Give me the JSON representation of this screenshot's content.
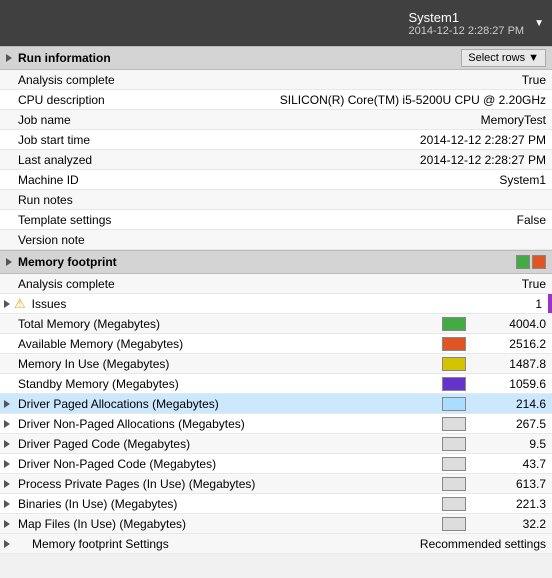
{
  "header": {
    "system_name": "System1",
    "system_date": "2014-12-12 2:28:27 PM",
    "dropdown_label": "System1"
  },
  "run_info": {
    "section_title": "Run information",
    "select_rows_label": "Select rows",
    "rows": [
      {
        "label": "Analysis complete",
        "value": "True",
        "indent": false
      },
      {
        "label": "CPU description",
        "value": "SILICON(R) Core(TM) i5-5200U CPU @ 2.20GHz",
        "indent": false
      },
      {
        "label": "Job name",
        "value": "MemoryTest",
        "indent": false
      },
      {
        "label": "Job start time",
        "value": "2014-12-12 2:28:27 PM",
        "indent": false
      },
      {
        "label": "Last analyzed",
        "value": "2014-12-12 2:28:27 PM",
        "indent": false
      },
      {
        "label": "Machine ID",
        "value": "System1",
        "indent": false
      },
      {
        "label": "Run notes",
        "value": "",
        "indent": false
      },
      {
        "label": "Template settings",
        "value": "False",
        "indent": false
      },
      {
        "label": "Version note",
        "value": "",
        "indent": false
      }
    ]
  },
  "memory_footprint": {
    "section_title": "Memory footprint",
    "color_boxes": [
      "#44aa44",
      "#e05522"
    ],
    "rows": [
      {
        "label": "Analysis complete",
        "value": "True",
        "color": null,
        "indent": false,
        "expandable": false,
        "issues": false
      },
      {
        "label": "Issues",
        "value": "1",
        "color": null,
        "indent": false,
        "expandable": true,
        "issues": true
      },
      {
        "label": "Total Memory (Megabytes)",
        "value": "4004.0",
        "color": "#44aa44",
        "indent": false,
        "expandable": false,
        "issues": false
      },
      {
        "label": "Available Memory (Megabytes)",
        "value": "2516.2",
        "color": "#e05522",
        "indent": false,
        "expandable": false,
        "issues": false
      },
      {
        "label": "Memory In Use (Megabytes)",
        "value": "1487.8",
        "color": "#d4c400",
        "indent": false,
        "expandable": false,
        "issues": false
      },
      {
        "label": "Standby Memory (Megabytes)",
        "value": "1059.6",
        "color": "#6633cc",
        "indent": false,
        "expandable": false,
        "issues": false
      },
      {
        "label": "Driver Paged Allocations (Megabytes)",
        "value": "214.6",
        "color": "#aaddff",
        "indent": false,
        "expandable": true,
        "issues": false,
        "selected": true
      },
      {
        "label": "Driver Non-Paged Allocations (Megabytes)",
        "value": "267.5",
        "color": "#dddddd",
        "indent": false,
        "expandable": true,
        "issues": false
      },
      {
        "label": "Driver Paged Code (Megabytes)",
        "value": "9.5",
        "color": "#dddddd",
        "indent": false,
        "expandable": true,
        "issues": false
      },
      {
        "label": "Driver Non-Paged Code (Megabytes)",
        "value": "43.7",
        "color": "#dddddd",
        "indent": false,
        "expandable": true,
        "issues": false
      },
      {
        "label": "Process Private Pages (In Use) (Megabytes)",
        "value": "613.7",
        "color": "#dddddd",
        "indent": false,
        "expandable": true,
        "issues": false
      },
      {
        "label": "Binaries (In Use) (Megabytes)",
        "value": "221.3",
        "color": "#dddddd",
        "indent": false,
        "expandable": true,
        "issues": false
      },
      {
        "label": "Map Files (In Use) (Megabytes)",
        "value": "32.2",
        "color": "#dddddd",
        "indent": false,
        "expandable": true,
        "issues": false
      }
    ],
    "footer_label": "Memory footprint Settings",
    "footer_value": "Recommended settings"
  }
}
